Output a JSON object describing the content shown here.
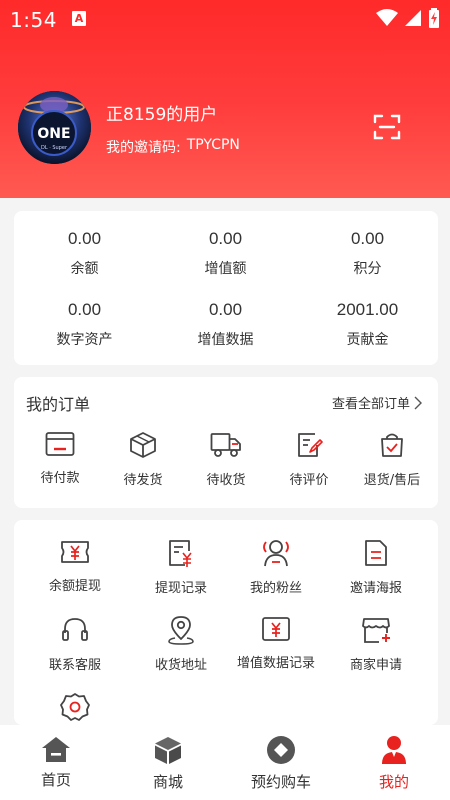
{
  "status_bar": {
    "time": "1:54",
    "notification_letter": "A"
  },
  "profile": {
    "username": "正8159的用户",
    "invite_label": "我的邀请码:",
    "invite_code": "TPYCPN"
  },
  "stats": [
    {
      "value": "0.00",
      "label": "余额"
    },
    {
      "value": "0.00",
      "label": "增值额"
    },
    {
      "value": "0.00",
      "label": "积分"
    },
    {
      "value": "0.00",
      "label": "数字资产"
    },
    {
      "value": "0.00",
      "label": "增值数据"
    },
    {
      "value": "2001.00",
      "label": "贡献金"
    }
  ],
  "orders": {
    "title": "我的订单",
    "view_all": "查看全部订单",
    "items": [
      {
        "label": "待付款",
        "icon": "wallet-icon"
      },
      {
        "label": "待发货",
        "icon": "package-icon"
      },
      {
        "label": "待收货",
        "icon": "truck-icon"
      },
      {
        "label": "待评价",
        "icon": "review-icon"
      },
      {
        "label": "退货/售后",
        "icon": "return-bag-icon"
      }
    ]
  },
  "tools": [
    {
      "label": "余额提现",
      "icon": "yuan-ticket-icon"
    },
    {
      "label": "提现记录",
      "icon": "yuan-record-icon"
    },
    {
      "label": "我的粉丝",
      "icon": "fans-icon"
    },
    {
      "label": "邀请海报",
      "icon": "poster-icon"
    },
    {
      "label": "联系客服",
      "icon": "headset-icon"
    },
    {
      "label": "收货地址",
      "icon": "location-icon"
    },
    {
      "label": "增值数据记录",
      "icon": "yuan-card-icon"
    },
    {
      "label": "商家申请",
      "icon": "store-apply-icon"
    },
    {
      "label": "",
      "icon": "settings-icon"
    }
  ],
  "tabbar": {
    "items": [
      {
        "label": "首页",
        "icon": "home-icon"
      },
      {
        "label": "商城",
        "icon": "cube-icon"
      },
      {
        "label": "预约购车",
        "icon": "diamond-circle-icon"
      },
      {
        "label": "我的",
        "icon": "user-icon"
      }
    ],
    "active_index": 3
  },
  "colors": {
    "brand": "#ff2a2a",
    "accent": "#e8231f",
    "icon_gray": "#444444",
    "tab_gray": "#666666"
  }
}
